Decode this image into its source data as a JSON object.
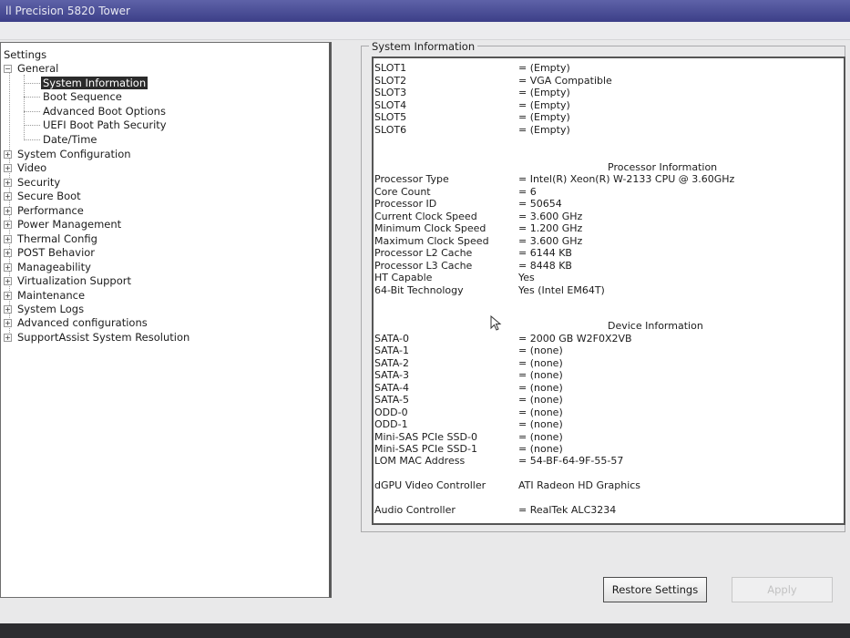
{
  "window": {
    "title": "ll Precision 5820 Tower"
  },
  "tree": {
    "root": "Settings",
    "general": "General",
    "children": [
      "System Information",
      "Boot Sequence",
      "Advanced Boot Options",
      "UEFI Boot Path Security",
      "Date/Time"
    ],
    "items": [
      "System Configuration",
      "Video",
      "Security",
      "Secure Boot",
      "Performance",
      "Power Management",
      "Thermal Config",
      "POST Behavior",
      "Manageability",
      "Virtualization Support",
      "Maintenance",
      "System Logs",
      "Advanced configurations",
      "SupportAssist System Resolution"
    ],
    "toggle_expanded": "−",
    "toggle_collapsed": "+"
  },
  "info": {
    "group_title": "System Information",
    "slots": [
      {
        "label": "SLOT1",
        "value": "= (Empty)"
      },
      {
        "label": "SLOT2",
        "value": "= VGA Compatible"
      },
      {
        "label": "SLOT3",
        "value": "= (Empty)"
      },
      {
        "label": "SLOT4",
        "value": "= (Empty)"
      },
      {
        "label": "SLOT5",
        "value": "= (Empty)"
      },
      {
        "label": "SLOT6",
        "value": "= (Empty)"
      }
    ],
    "processor_header": "Processor Information",
    "processor": [
      {
        "label": "Processor Type",
        "value": "= Intel(R) Xeon(R) W-2133 CPU @ 3.60GHz"
      },
      {
        "label": "Core Count",
        "value": "= 6"
      },
      {
        "label": "Processor ID",
        "value": "= 50654"
      },
      {
        "label": "Current Clock Speed",
        "value": "= 3.600 GHz"
      },
      {
        "label": "Minimum Clock Speed",
        "value": "= 1.200 GHz"
      },
      {
        "label": "Maximum Clock Speed",
        "value": "= 3.600 GHz"
      },
      {
        "label": "Processor L2 Cache",
        "value": "= 6144 KB"
      },
      {
        "label": "Processor L3 Cache",
        "value": "= 8448 KB"
      },
      {
        "label": "HT Capable",
        "value": "Yes"
      },
      {
        "label": "64-Bit Technology",
        "value": "Yes (Intel EM64T)"
      }
    ],
    "device_header": "Device Information",
    "devices": [
      {
        "label": "SATA-0",
        "value": "= 2000 GB W2F0X2VB"
      },
      {
        "label": "SATA-1",
        "value": "= (none)"
      },
      {
        "label": "SATA-2",
        "value": "= (none)"
      },
      {
        "label": "SATA-3",
        "value": "= (none)"
      },
      {
        "label": "SATA-4",
        "value": "= (none)"
      },
      {
        "label": "SATA-5",
        "value": "= (none)"
      },
      {
        "label": "ODD-0",
        "value": "= (none)"
      },
      {
        "label": "ODD-1",
        "value": "= (none)"
      },
      {
        "label": "Mini-SAS PCIe SSD-0",
        "value": "= (none)"
      },
      {
        "label": "Mini-SAS PCIe SSD-1",
        "value": "= (none)"
      },
      {
        "label": "LOM MAC Address",
        "value": "= 54-BF-64-9F-55-57"
      }
    ],
    "gpu": {
      "label": "dGPU Video Controller",
      "value": "ATI Radeon HD Graphics"
    },
    "audio": {
      "label": "Audio Controller",
      "value": "= RealTek ALC3234"
    }
  },
  "buttons": {
    "restore": "Restore Settings",
    "apply": "Apply"
  }
}
